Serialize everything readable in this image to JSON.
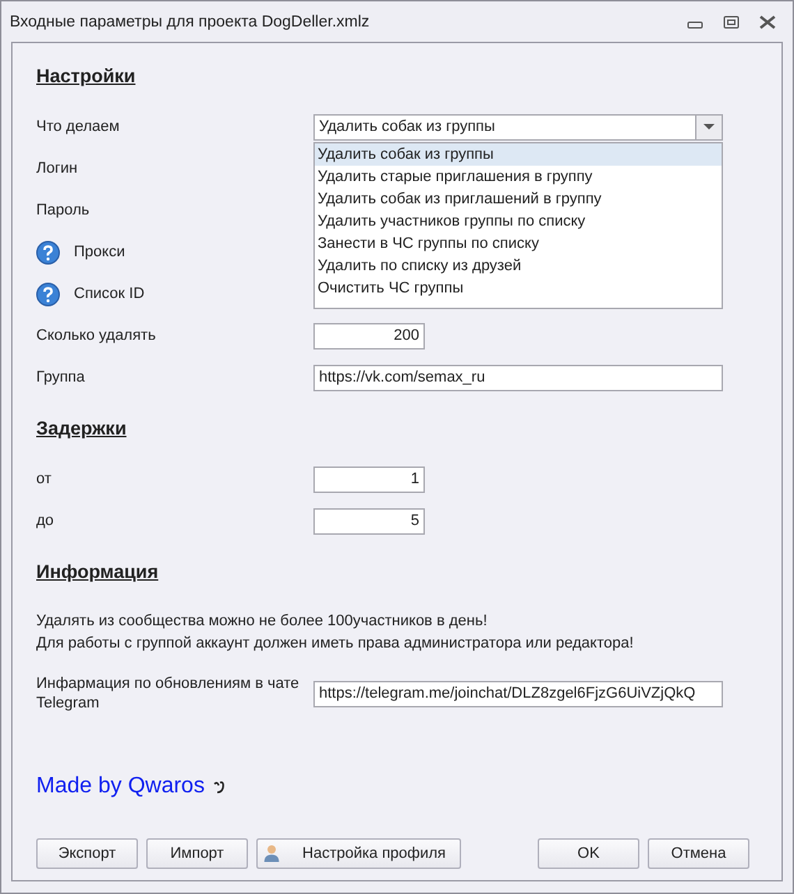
{
  "window": {
    "title": "Входные параметры для проекта DogDeller.xmlz"
  },
  "settings": {
    "heading": "Настройки",
    "rows": [
      {
        "label": "Что делаем",
        "kind": "combo",
        "value": "Удалить собак из группы",
        "help": false,
        "options": [
          {
            "label": "Удалить собак из группы",
            "selected": true
          },
          {
            "label": "Удалить старые приглашения в группу",
            "selected": false
          },
          {
            "label": "Удалить собак из приглашений в группу",
            "selected": false
          },
          {
            "label": "Удалить участников группы по списку",
            "selected": false
          },
          {
            "label": "Занести в ЧС группы по списку",
            "selected": false
          },
          {
            "label": "Удалить по списку из друзей",
            "selected": false
          },
          {
            "label": "Очистить ЧС группы",
            "selected": false
          }
        ]
      },
      {
        "label": "Логин",
        "kind": "covered",
        "help": false
      },
      {
        "label": "Пароль",
        "kind": "covered",
        "help": false
      },
      {
        "label": "Прокси",
        "kind": "covered",
        "help": true
      },
      {
        "label": "Список ID",
        "kind": "covered",
        "help": true
      },
      {
        "label": "Сколько удалять",
        "kind": "number",
        "value": "200",
        "help": false
      },
      {
        "label": "Группа",
        "kind": "text",
        "value": "https://vk.com/semax_ru",
        "help": false
      }
    ]
  },
  "delays": {
    "heading": "Задержки",
    "rows": [
      {
        "label": "от",
        "kind": "number",
        "value": "1",
        "help": false
      },
      {
        "label": "до",
        "kind": "number",
        "value": "5",
        "help": false
      }
    ]
  },
  "info": {
    "heading": "Информация",
    "notes": [
      "Удалять из сообщества можно не более 100участников в день!",
      "Для работы с группой аккаунт должен иметь права администратора или редактора!"
    ],
    "rows": [
      {
        "label": "Инфармация по обновлениям в чате Telegram",
        "kind": "text",
        "value": "https://telegram.me/joinchat/DLZ8zgel6FjzG6UiVZjQkQ",
        "help": false
      }
    ]
  },
  "credit": {
    "text": "Made by Qwaros"
  },
  "buttons_left": [
    {
      "label": "Экспорт",
      "icon": false
    },
    {
      "label": "Импорт",
      "icon": false
    },
    {
      "label": "Настройка профиля",
      "icon": true
    }
  ],
  "buttons_right": [
    {
      "label": "OK"
    },
    {
      "label": "Отмена"
    }
  ]
}
